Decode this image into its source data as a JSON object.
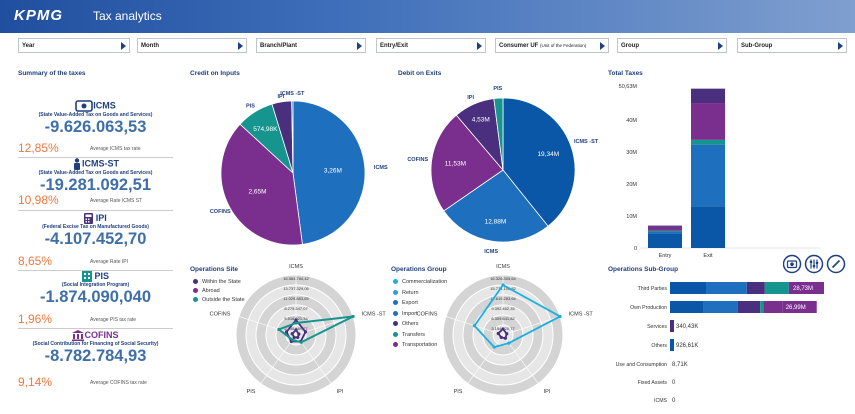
{
  "header": {
    "logo": "KPMG",
    "title": "Tax analytics"
  },
  "filters": [
    {
      "label": "Year",
      "sub": ""
    },
    {
      "label": "Month",
      "sub": ""
    },
    {
      "label": "Branch/Plant",
      "sub": ""
    },
    {
      "label": "Entry/Exit",
      "sub": ""
    },
    {
      "label": "Consumer UF",
      "sub": "(Unit of the Federation)"
    },
    {
      "label": "Group",
      "sub": ""
    },
    {
      "label": "Sub-Group",
      "sub": ""
    }
  ],
  "summary": {
    "title": "Summary of the taxes",
    "items": [
      {
        "name": "ICMS",
        "desc": "(State Value-Added Tax on Goods and Services)",
        "value": "-9.626.063,53",
        "rate": "12,85%",
        "rate_label": "Average ICMS tax rate",
        "icon": "money-icon"
      },
      {
        "name": "ICMS-ST",
        "desc": "(State Value-Added Tax on Goods and Services)",
        "value": "-19.281.092,51",
        "rate": "10,98%",
        "rate_label": "Average Rate ICMS ST",
        "icon": "person-icon"
      },
      {
        "name": "IPI",
        "desc": "(Federal Excise Tax on Manufactured Goods)",
        "value": "-4.107.452,70",
        "rate": "8,65%",
        "rate_label": "Average Rate IPI",
        "icon": "calculator-icon"
      },
      {
        "name": "PIS",
        "desc": "(Social Integration Program)",
        "value": "-1.874.090,040",
        "rate": "1,96%",
        "rate_label": "Average PIS tax rate",
        "icon": "building-icon"
      },
      {
        "name": "COFINS",
        "desc": "(Social Contribution for Financing of Social Security)",
        "value": "-8.782.784,93",
        "rate": "9,14%",
        "rate_label": "Average COFINS tax rate",
        "icon": "bank-icon"
      }
    ]
  },
  "colors": {
    "icms": "#1f6fbf",
    "icmsst": "#0a57a8",
    "cofins": "#7a2f8f",
    "pis": "#16958f",
    "ipi": "#4a2f7f",
    "dark": "#1f3f7f",
    "orange": "#f07840",
    "cyan": "#1ab0e0"
  },
  "charts": {
    "credit": {
      "title": "Credit on Inputs"
    },
    "debit": {
      "title": "Debit on Exits"
    },
    "total": {
      "title": "Total Taxes"
    },
    "site": {
      "title": "Operations Site"
    },
    "group": {
      "title": "Operations Group"
    },
    "subgroup": {
      "title": "Operations Sub-Group"
    }
  },
  "chart_data": [
    {
      "type": "pie",
      "title": "Credit on Inputs",
      "slices": [
        {
          "label": "ICMS",
          "value": 3.26,
          "text": "3,26M"
        },
        {
          "label": "COFINS",
          "value": 2.65,
          "text": "2,65M"
        },
        {
          "label": "PIS",
          "value": 0.57498,
          "text": "574,98K"
        },
        {
          "label": "IPI",
          "value": 0.3,
          "text": ""
        },
        {
          "label": "ICMS -ST",
          "value": 0.02,
          "text": ""
        }
      ]
    },
    {
      "type": "pie",
      "title": "Debit on Exits",
      "slices": [
        {
          "label": "ICMS -ST",
          "value": 19.34,
          "text": "19,34M"
        },
        {
          "label": "ICMS",
          "value": 12.88,
          "text": "12,88M"
        },
        {
          "label": "COFINS",
          "value": 11.53,
          "text": "11,53M"
        },
        {
          "label": "IPI",
          "value": 4.53,
          "text": "4,53M"
        },
        {
          "label": "PIS",
          "value": 1.0,
          "text": ""
        }
      ]
    },
    {
      "type": "bar",
      "title": "Total Taxes",
      "categories": [
        "Entry",
        "Exit"
      ],
      "ylim": [
        0,
        50.63
      ],
      "ticks": [
        "0",
        "10M",
        "20M",
        "30M",
        "40M",
        "50,63M"
      ],
      "tick_values": [
        0,
        10,
        20,
        30,
        40,
        50.63
      ],
      "series": [
        {
          "key": "icmsst",
          "values": [
            4.5,
            13
          ]
        },
        {
          "key": "icms",
          "values": [
            0.5,
            19.3
          ]
        },
        {
          "key": "pis",
          "values": [
            0.4,
            1.5
          ]
        },
        {
          "key": "cofins",
          "values": [
            1.2,
            11.5
          ]
        },
        {
          "key": "ipi",
          "values": [
            0.4,
            4.5
          ]
        }
      ]
    },
    {
      "type": "radar",
      "title": "Operations Site",
      "axes": [
        "ICMS",
        "ICMS -ST",
        "IPI",
        "PIS",
        "COFINS"
      ],
      "rings": [
        "16.564.784,42",
        "13.737.329,05",
        "11.029.883,05",
        "8.275.347,07",
        "5.516.921,34",
        "2.758.589,77"
      ],
      "legend": [
        "Within the State",
        "Abroad",
        "Outside the State"
      ],
      "series": [
        {
          "name": "Within the State",
          "values": [
            1.5,
            1.0,
            0.8,
            0.8,
            1.0
          ]
        },
        {
          "name": "Abroad",
          "values": [
            0.5,
            0.3,
            0.3,
            0.3,
            0.4
          ]
        },
        {
          "name": "Outside the State",
          "values": [
            1.2,
            6.0,
            0.9,
            0.6,
            1.8
          ]
        }
      ]
    },
    {
      "type": "radar",
      "title": "Operations Group",
      "axes": [
        "ICMS",
        "ICMS -ST",
        "IPI",
        "PIS",
        "COFINS"
      ],
      "rings": [
        "16.326.305,64",
        "15.774.102,82",
        "12.619.283,64",
        "9.392.462,35",
        "6.309.641,82",
        "3.154.820,77"
      ],
      "legend": [
        "Commercialization",
        "Return",
        "Export",
        "Import",
        "Others",
        "Transfers",
        "Transportation"
      ],
      "series": [
        {
          "name": "Commercialization",
          "values": [
            5.0,
            6.0,
            1.0,
            1.5,
            3.0
          ]
        },
        {
          "name": "Others",
          "values": [
            0.6,
            0.4,
            0.4,
            0.3,
            0.5
          ]
        }
      ]
    },
    {
      "type": "bar",
      "orientation": "horizontal",
      "title": "Operations Sub-Group",
      "categories": [
        "Third Parties",
        "Own Production",
        "Services",
        "Others",
        "Use and Consumption",
        "Fixed Assets",
        "ICMS"
      ],
      "labels": [
        "28,73M",
        "26,99M",
        "340,43K",
        "926,61K",
        "8,71K",
        "0",
        "0"
      ],
      "values": [
        28.73,
        26.99,
        0.34043,
        0.92661,
        0.00871,
        0,
        0
      ]
    }
  ],
  "bottom_icons": [
    "camera-icon",
    "sliders-icon",
    "edit-icon"
  ]
}
